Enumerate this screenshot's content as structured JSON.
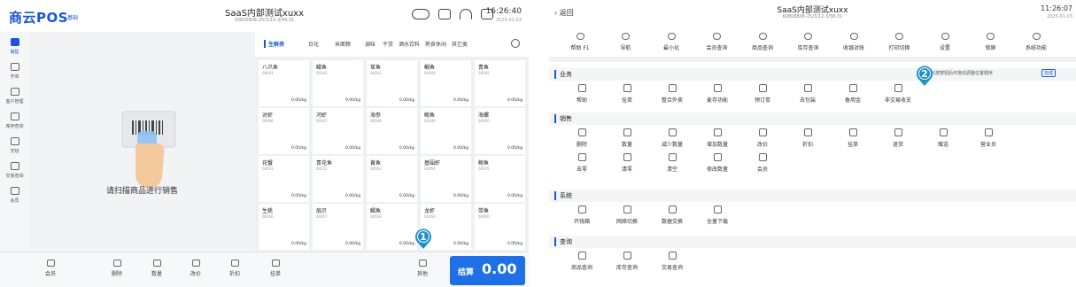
{
  "left": {
    "logo": "商云POS",
    "logo_badge": "基础",
    "title": "SaaS内部测试xuxx",
    "subtitle": "30830806-25/3/10-3/58-31",
    "time": "16:26:40",
    "date": "2025-01-03",
    "sidebar": [
      {
        "label": "销售",
        "icon": "cart-icon"
      },
      {
        "label": "开单",
        "icon": "order-icon"
      },
      {
        "label": "客户管理",
        "icon": "people-icon"
      },
      {
        "label": "库存查询",
        "icon": "warehouse-icon"
      },
      {
        "label": "交班",
        "icon": "shift-icon"
      },
      {
        "label": "交易查询",
        "icon": "search-doc-icon"
      },
      {
        "label": "会员",
        "icon": "member-icon"
      }
    ],
    "scan_message": "请扫描商品进行销售",
    "categories": [
      "生鲜类",
      "日化",
      "米面粮",
      "调味",
      "干货",
      "酒水饮料",
      "熟食休闲",
      "其它类"
    ],
    "products": [
      {
        "name": "八爪鱼",
        "code": "00041",
        "price": "0.00/kg"
      },
      {
        "name": "鲳鱼",
        "code": "00042",
        "price": "9.00/kg"
      },
      {
        "name": "草鱼",
        "code": "00043",
        "price": "0.00/kg"
      },
      {
        "name": "鲷鱼",
        "code": "00044",
        "price": "0.00/kg"
      },
      {
        "name": "青鱼",
        "code": "00045",
        "price": "0.00/kg"
      },
      {
        "name": "对虾",
        "code": "00046",
        "price": "0.00/kg"
      },
      {
        "name": "河虾",
        "code": "00047",
        "price": "0.00/kg"
      },
      {
        "name": "海参",
        "code": "00048",
        "price": "0.00/kg"
      },
      {
        "name": "鲍鱼",
        "code": "00049",
        "price": "0.00/kg"
      },
      {
        "name": "海螺",
        "code": "00050",
        "price": "0.00/kg"
      },
      {
        "name": "花蟹",
        "code": "00051",
        "price": "0.00/kg"
      },
      {
        "name": "青花鱼",
        "code": "00052",
        "price": "0.00/kg"
      },
      {
        "name": "黄鱼",
        "code": "00053",
        "price": "0.00/kg"
      },
      {
        "name": "基围虾",
        "code": "00054",
        "price": "0.00/kg"
      },
      {
        "name": "鲍鱼",
        "code": "00055",
        "price": "0.00/kg"
      },
      {
        "name": "生蚝",
        "code": "00056",
        "price": "0.00/kg"
      },
      {
        "name": "扇贝",
        "code": "00057",
        "price": "0.00/kg"
      },
      {
        "name": "鲳鱼",
        "code": "00058",
        "price": "0.00/kg"
      },
      {
        "name": "龙虾",
        "code": "00059",
        "price": "0.00/kg"
      },
      {
        "name": "带鱼",
        "code": "00060",
        "price": "0.00/kg"
      }
    ],
    "bottom": [
      {
        "label": "会员",
        "icon": "member-icon"
      },
      {
        "label": "删除",
        "icon": "delete-icon"
      },
      {
        "label": "数量",
        "icon": "quantity-icon"
      },
      {
        "label": "改价",
        "icon": "edit-price-icon"
      },
      {
        "label": "折扣",
        "icon": "discount-icon"
      },
      {
        "label": "挂单",
        "icon": "hold-order-icon"
      },
      {
        "label": "其他",
        "icon": "more-icon"
      }
    ],
    "checkout_label": "结算",
    "checkout_amount": "0.00",
    "marker_1": "1"
  },
  "right": {
    "back": "返回",
    "title": "SaaS内部测试xuxx",
    "subtitle": "60808806-25/3/12-3/58-31",
    "time": "11:26:07",
    "date": "2025-01-03",
    "toolbar": [
      {
        "label": "帮助 F1",
        "icon": "help-icon"
      },
      {
        "label": "导航",
        "icon": "navigation-icon"
      },
      {
        "label": "最小化",
        "icon": "minimize-icon"
      },
      {
        "label": "会员查询",
        "icon": "member-search-icon"
      },
      {
        "label": "商品查询",
        "icon": "product-search-icon"
      },
      {
        "label": "库存查询",
        "icon": "stock-search-icon"
      },
      {
        "label": "收银对账",
        "icon": "reconcile-icon"
      },
      {
        "label": "打印切换",
        "icon": "printer-icon"
      },
      {
        "label": "设置",
        "icon": "settings-icon"
      },
      {
        "label": "锁屏",
        "icon": "lock-icon"
      },
      {
        "label": "系统功能",
        "icon": "grid-icon"
      }
    ],
    "sections": [
      {
        "title": "业务",
        "items": [
          {
            "label": "帮助",
            "icon": "help-icon"
          },
          {
            "label": "挂单",
            "icon": "hold-order-icon"
          },
          {
            "label": "整合外卖",
            "icon": "takeout-icon"
          },
          {
            "label": "麦存功能",
            "icon": "store-icon"
          },
          {
            "label": "预订单",
            "icon": "preorder-icon"
          },
          {
            "label": "去包装",
            "icon": "unpack-icon"
          },
          {
            "label": "备用金",
            "icon": "cash-icon"
          },
          {
            "label": "非交易收支",
            "icon": "ledger-icon"
          }
        ]
      },
      {
        "title": "销售",
        "items": [
          {
            "label": "删除",
            "icon": "delete-icon"
          },
          {
            "label": "数量",
            "icon": "quantity-icon"
          },
          {
            "label": "减少数量",
            "icon": "decrease-icon"
          },
          {
            "label": "增加数量",
            "icon": "increase-icon"
          },
          {
            "label": "改价",
            "icon": "edit-price-icon"
          },
          {
            "label": "折扣",
            "icon": "discount-icon"
          },
          {
            "label": "挂单",
            "icon": "hold-order-icon"
          },
          {
            "label": "退货",
            "icon": "return-icon"
          },
          {
            "label": "赠送",
            "icon": "gift-icon"
          },
          {
            "label": "营业员",
            "icon": "clerk-icon"
          },
          {
            "label": "去零",
            "icon": "round-icon"
          },
          {
            "label": "清零",
            "icon": "clear-icon"
          },
          {
            "label": "清空",
            "icon": "erase-icon"
          },
          {
            "label": "修改数量",
            "icon": "modify-quantity-icon"
          },
          {
            "label": "会员",
            "icon": "member-icon"
          }
        ]
      },
      {
        "title": "系统",
        "items": [
          {
            "label": "开钱箱",
            "icon": "cashbox-icon"
          },
          {
            "label": "网络切换",
            "icon": "network-icon"
          },
          {
            "label": "数据交换",
            "icon": "data-sync-icon"
          },
          {
            "label": "全量下载",
            "icon": "download-icon"
          }
        ]
      },
      {
        "title": "查询",
        "items": [
          {
            "label": "商品查询",
            "icon": "product-search-icon"
          },
          {
            "label": "库存查询",
            "icon": "stock-search-icon"
          },
          {
            "label": "交易查询",
            "icon": "trade-search-icon"
          }
        ]
      }
    ],
    "hint": "长按按钮后可拖动调整位置顺序",
    "hint_tag": "完成",
    "marker_2": "2"
  },
  "colors": {
    "accent": "#1f6fe6",
    "marker": "#1e90c8"
  }
}
